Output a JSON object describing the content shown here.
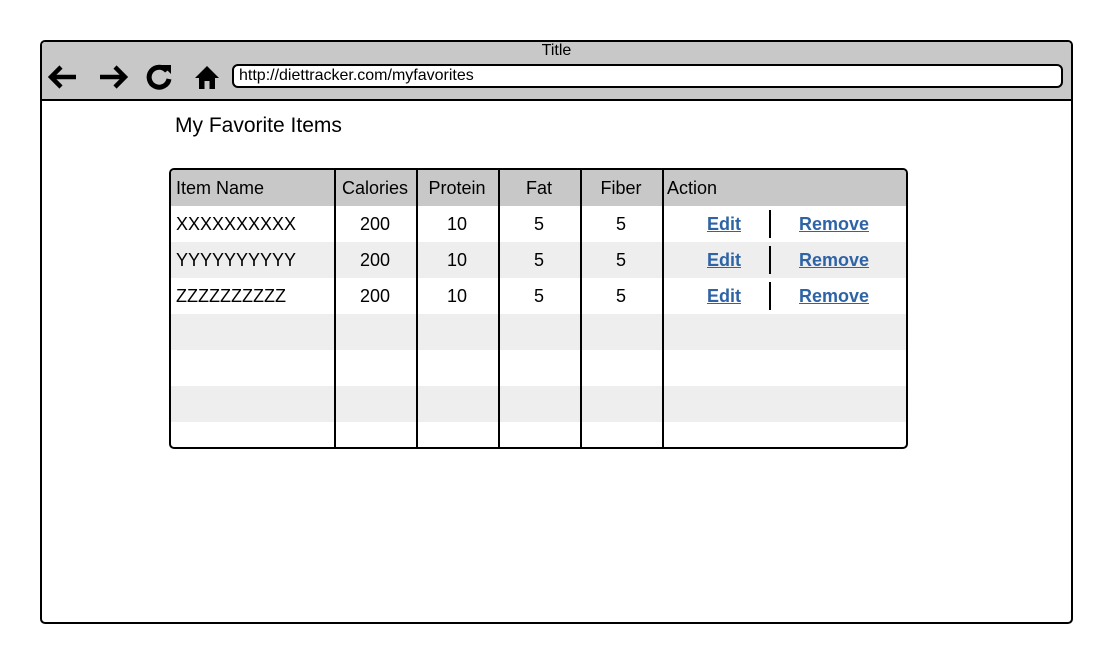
{
  "window": {
    "title": "Title"
  },
  "browser": {
    "url": "http://diettracker.com/myfavorites",
    "nav_icons": [
      "back-arrow-icon",
      "forward-arrow-icon",
      "reload-icon",
      "home-icon"
    ]
  },
  "page": {
    "heading": "My Favorite Items"
  },
  "table": {
    "headers": [
      "Item Name",
      "Calories",
      "Protein",
      "Fat",
      "Fiber",
      "Action"
    ],
    "rows": [
      {
        "name": "XXXXXXXXXX",
        "calories": "200",
        "protein": "10",
        "fat": "5",
        "fiber": "5",
        "edit": "Edit",
        "remove": "Remove"
      },
      {
        "name": "YYYYYYYYYY",
        "calories": "200",
        "protein": "10",
        "fat": "5",
        "fiber": "5",
        "edit": "Edit",
        "remove": "Remove"
      },
      {
        "name": "ZZZZZZZZZZ",
        "calories": "200",
        "protein": "10",
        "fat": "5",
        "fiber": "5",
        "edit": "Edit",
        "remove": "Remove"
      }
    ]
  },
  "colors": {
    "chrome": "#c8c8c8",
    "stripe": "#eeeeee",
    "link": "#2e63a6"
  }
}
